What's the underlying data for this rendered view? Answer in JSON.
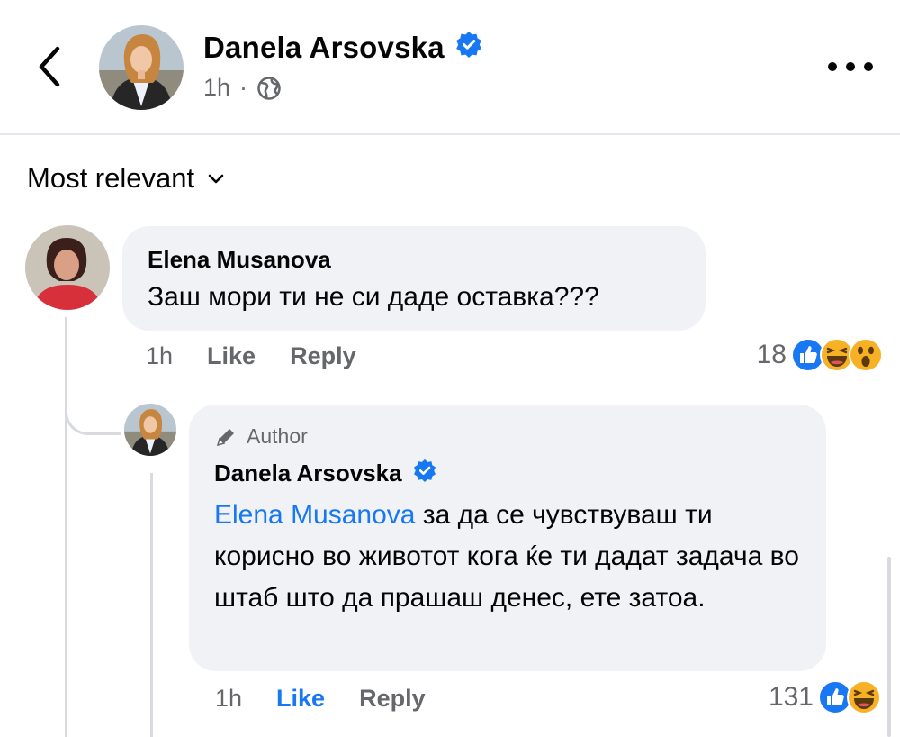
{
  "header": {
    "name": "Danela Arsovska",
    "time": "1h",
    "separator": "·",
    "privacy_icon": "globe-icon",
    "verified_icon": "verified-badge-icon",
    "back_icon": "chevron-left-icon",
    "more_icon": "more-horizontal-icon"
  },
  "sort": {
    "label": "Most relevant",
    "icon": "chevron-down-icon"
  },
  "comments": [
    {
      "author": "Elena Musanova",
      "text": "Заш мори ти не си даде оставка???",
      "time": "1h",
      "like_label": "Like",
      "reply_label": "Reply",
      "reaction_count": "18",
      "reactions": [
        "like",
        "haha",
        "wow"
      ]
    },
    {
      "badge_label": "Author",
      "badge_icon": "pencil-icon",
      "author": "Danela Arsovska",
      "mention": "Elena Musanova",
      "text": " за да се чувствуваш ти корисно во животот кога ќе ти дадат задача во штаб што да прашаш денес, ете затоа.",
      "time": "1h",
      "like_label": "Like",
      "liked": true,
      "reply_label": "Reply",
      "reaction_count": "131",
      "reactions": [
        "like",
        "haha"
      ]
    }
  ],
  "colors": {
    "accent": "#1877f2",
    "bubble": "#f0f2f5",
    "secondary_text": "#65676b",
    "reaction_like": "#1877f2",
    "reaction_emoji": "#f7b125"
  }
}
